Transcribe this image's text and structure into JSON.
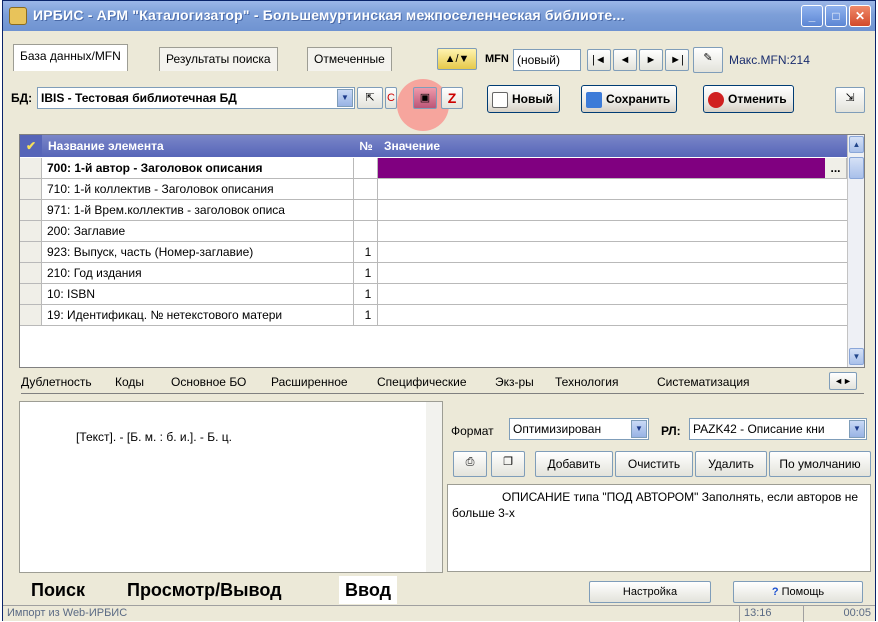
{
  "window": {
    "title": "ИРБИС - АРМ \"Каталогизатор\" - Большемуртинская межпоселенческая библиоте...",
    "minimize": "_",
    "maximize": "□",
    "close": "✕"
  },
  "top_tabs": [
    "База данных/MFN",
    "Результаты поиска",
    "Отмеченные"
  ],
  "mfn": {
    "label": "MFN",
    "value": "(новый)",
    "nav": [
      "|◄",
      "◄",
      "►",
      "►|"
    ],
    "max_label": "Макс.MFN:214"
  },
  "db": {
    "label": "БД:",
    "value": "IBIS - Тестовая библиотечная БД"
  },
  "toolbar": {
    "new": "Новый",
    "save": "Сохранить",
    "cancel": "Отменить"
  },
  "grid": {
    "headers": {
      "name": "Название элемента",
      "num": "№",
      "value": "Значение"
    },
    "rows": [
      {
        "name": "700: 1-й  автор - Заголовок описания",
        "num": "",
        "value": ""
      },
      {
        "name": "710: 1-й коллектив - Заголовок описания",
        "num": "",
        "value": ""
      },
      {
        "name": "971: 1-й Врем.коллектив - заголовок описа",
        "num": "",
        "value": ""
      },
      {
        "name": "200: Заглавие",
        "num": "",
        "value": ""
      },
      {
        "name": "923: Выпуск, часть (Номер-заглавие)",
        "num": "1",
        "value": ""
      },
      {
        "name": "210: Год издания",
        "num": "1",
        "value": ""
      },
      {
        "name": "10: ISBN",
        "num": "1",
        "value": ""
      },
      {
        "name": "19: Идентификац. № нетекстового матери",
        "num": "1",
        "value": ""
      }
    ],
    "ellipsis": "..."
  },
  "subtabs": [
    "Дублетность",
    "Коды",
    "Основное БО",
    "Расширенное",
    "Специфические",
    "Экз-ры",
    "Технология",
    "Систематизация"
  ],
  "preview": {
    "text": "[Текст]. - [Б. м. : б. и.]. - Б. ц."
  },
  "format": {
    "label": "Формат",
    "value": "Оптимизирован",
    "rl_label": "РЛ:",
    "rl_value": "PAZK42 - Описание кни"
  },
  "format_buttons": [
    "Добавить",
    "Очистить",
    "Удалить",
    "По умолчанию"
  ],
  "description": "ОПИСАНИЕ типа \"ПОД АВТОРОМ\"     Заполнять, если авторов не больше 3-х",
  "bottom_tabs": [
    "Поиск",
    "Просмотр/Вывод",
    "Ввод"
  ],
  "bottom_buttons": {
    "settings": "Настройка",
    "help": "Помощь"
  },
  "status": {
    "left": "Импорт из Web-ИРБИС",
    "time": "13:16",
    "elapsed": "00:05"
  },
  "colors": {
    "title_bar": "#7d9fd8",
    "grid_header": "#5665b8",
    "selected_value": "#800080"
  }
}
